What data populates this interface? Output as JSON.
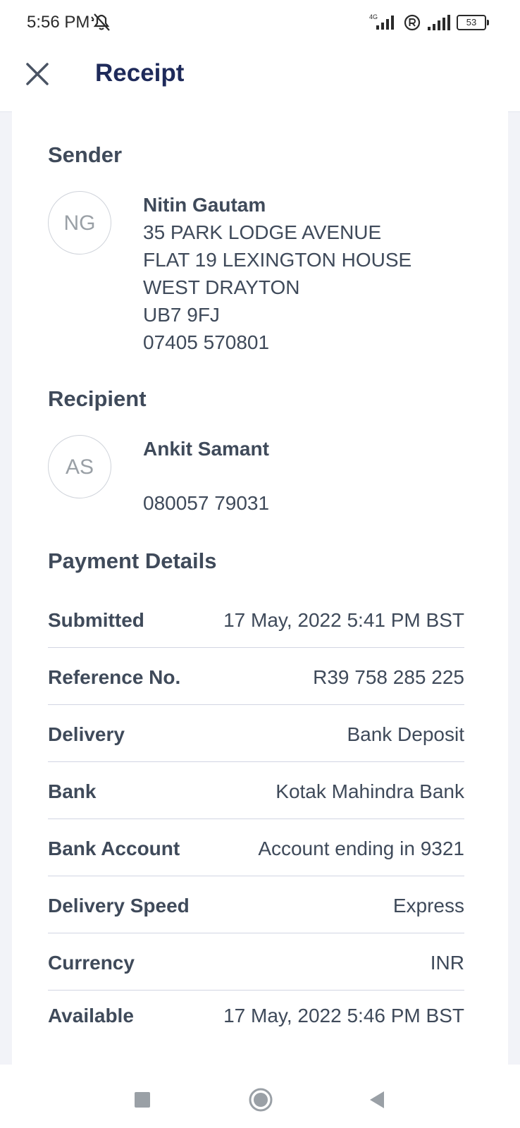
{
  "status_bar": {
    "time": "5:56 PM",
    "network": "4G",
    "battery": "53",
    "icons": [
      "mute-icon",
      "signal-icon",
      "roaming-icon",
      "signal-icon",
      "battery-icon"
    ]
  },
  "app_bar": {
    "title": "Receipt",
    "close_icon": "close-icon"
  },
  "sender": {
    "heading": "Sender",
    "initials": "NG",
    "name": "Nitin Gautam",
    "lines": [
      "35 PARK LODGE AVENUE",
      "FLAT 19 LEXINGTON HOUSE",
      "WEST DRAYTON",
      "UB7 9FJ",
      "07405 570801"
    ]
  },
  "recipient": {
    "heading": "Recipient",
    "initials": "AS",
    "name": "Ankit Samant",
    "phone": "080057 79031"
  },
  "payment": {
    "heading": "Payment Details",
    "rows": [
      {
        "label": "Submitted",
        "value": "17 May, 2022 5:41 PM BST"
      },
      {
        "label": "Reference No.",
        "value": "R39 758 285 225"
      },
      {
        "label": "Delivery",
        "value": "Bank Deposit"
      },
      {
        "label": "Bank",
        "value": "Kotak Mahindra Bank"
      },
      {
        "label": "Bank Account",
        "value": "Account ending in 9321"
      },
      {
        "label": "Delivery Speed",
        "value": "Express"
      },
      {
        "label": "Currency",
        "value": "INR"
      },
      {
        "label": "Available",
        "value": "17 May, 2022 5:46 PM BST"
      }
    ]
  },
  "nav_bar": {
    "buttons": [
      "recents-icon",
      "home-icon",
      "back-icon"
    ]
  },
  "colors": {
    "title": "#1e2a5a",
    "text": "#3f4a5a",
    "background": "#f2f3f8",
    "divider": "#d2d5e3"
  }
}
